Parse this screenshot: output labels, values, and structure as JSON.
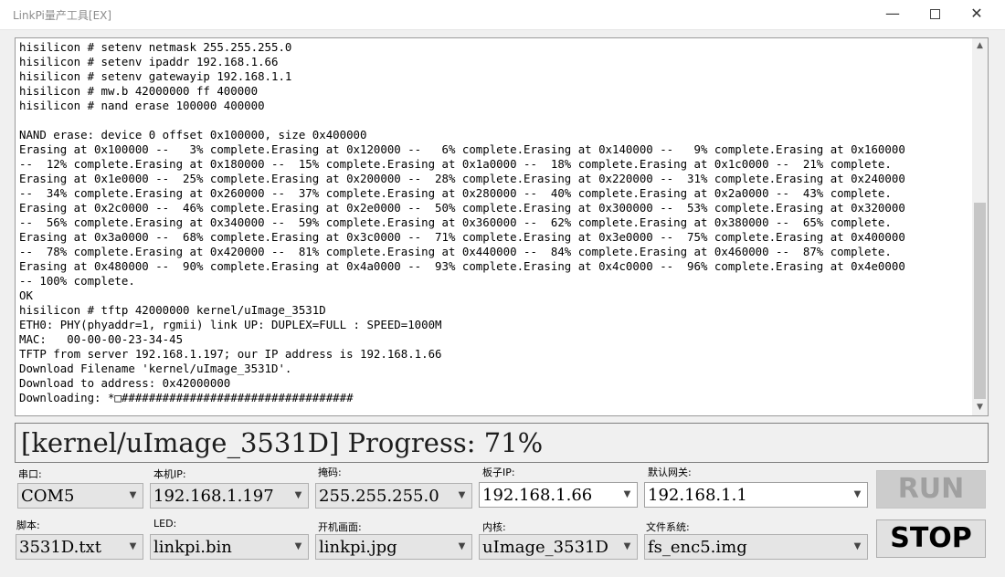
{
  "window": {
    "title": "LinkPi量产工具[EX]",
    "minimize_glyph": "—",
    "close_glyph": "✕"
  },
  "console": {
    "text": "hisilicon # setenv netmask 255.255.255.0\nhisilicon # setenv ipaddr 192.168.1.66\nhisilicon # setenv gatewayip 192.168.1.1\nhisilicon # mw.b 42000000 ff 400000\nhisilicon # nand erase 100000 400000\n\nNAND erase: device 0 offset 0x100000, size 0x400000\nErasing at 0x100000 --   3% complete.Erasing at 0x120000 --   6% complete.Erasing at 0x140000 --   9% complete.Erasing at 0x160000\n--  12% complete.Erasing at 0x180000 --  15% complete.Erasing at 0x1a0000 --  18% complete.Erasing at 0x1c0000 --  21% complete.\nErasing at 0x1e0000 --  25% complete.Erasing at 0x200000 --  28% complete.Erasing at 0x220000 --  31% complete.Erasing at 0x240000\n--  34% complete.Erasing at 0x260000 --  37% complete.Erasing at 0x280000 --  40% complete.Erasing at 0x2a0000 --  43% complete.\nErasing at 0x2c0000 --  46% complete.Erasing at 0x2e0000 --  50% complete.Erasing at 0x300000 --  53% complete.Erasing at 0x320000\n--  56% complete.Erasing at 0x340000 --  59% complete.Erasing at 0x360000 --  62% complete.Erasing at 0x380000 --  65% complete.\nErasing at 0x3a0000 --  68% complete.Erasing at 0x3c0000 --  71% complete.Erasing at 0x3e0000 --  75% complete.Erasing at 0x400000\n--  78% complete.Erasing at 0x420000 --  81% complete.Erasing at 0x440000 --  84% complete.Erasing at 0x460000 --  87% complete.\nErasing at 0x480000 --  90% complete.Erasing at 0x4a0000 --  93% complete.Erasing at 0x4c0000 --  96% complete.Erasing at 0x4e0000\n-- 100% complete.\nOK\nhisilicon # tftp 42000000 kernel/uImage_3531D\nETH0: PHY(phyaddr=1, rgmii) link UP: DUPLEX=FULL : SPEED=1000M\nMAC:   00-00-00-23-34-45\nTFTP from server 192.168.1.197; our IP address is 192.168.1.66\nDownload Filename 'kernel/uImage_3531D'.\nDownload to address: 0x42000000\nDownloading: *□##################################"
  },
  "progress": {
    "text": "[kernel/uImage_3531D] Progress: 71%",
    "percent": 71
  },
  "fields": {
    "serial": {
      "label": "串口:",
      "value": "COM5"
    },
    "local_ip": {
      "label": "本机IP:",
      "value": "192.168.1.197"
    },
    "netmask": {
      "label": "掩码:",
      "value": "255.255.255.0"
    },
    "board_ip": {
      "label": "板子IP:",
      "value": "192.168.1.66"
    },
    "gateway": {
      "label": "默认网关:",
      "value": "192.168.1.1"
    },
    "script": {
      "label": "脚本:",
      "value": "3531D.txt"
    },
    "led": {
      "label": "LED:",
      "value": "linkpi.bin"
    },
    "boot_image": {
      "label": "开机画面:",
      "value": "linkpi.jpg"
    },
    "kernel": {
      "label": "内核:",
      "value": "uImage_3531D"
    },
    "filesystem": {
      "label": "文件系统:",
      "value": "fs_enc5.img"
    }
  },
  "buttons": {
    "run": "RUN",
    "stop": "STOP"
  },
  "icons": {
    "dropdown": "chevron-down-icon",
    "scroll_up": "scroll-up-arrow-icon",
    "scroll_down": "scroll-down-arrow-icon"
  },
  "colors": {
    "console_bg": "#ffffff",
    "disabled_button_bg": "#cccccc",
    "disabled_button_text": "#a0a0a0"
  }
}
